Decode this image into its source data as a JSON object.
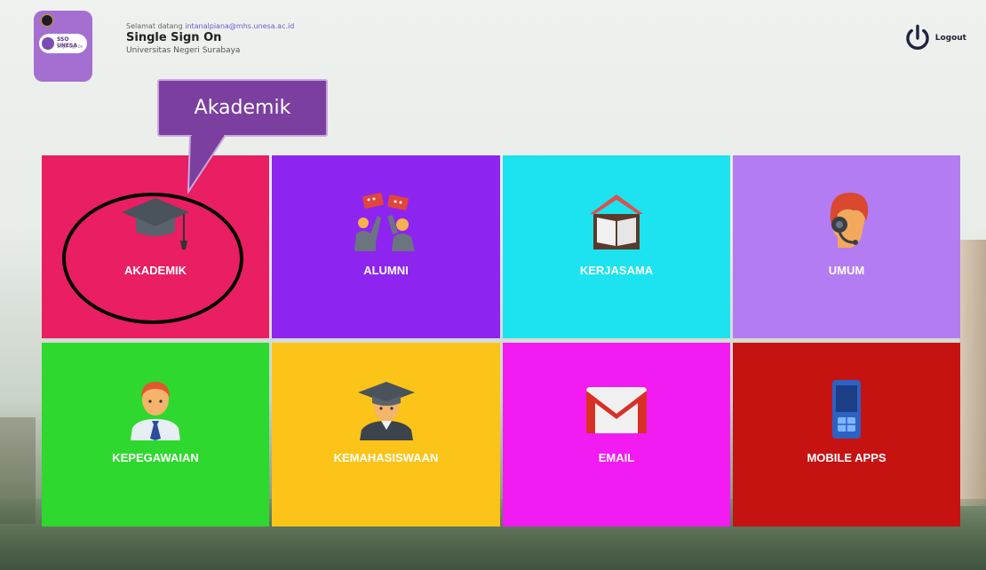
{
  "header": {
    "welcome_prefix": "Selamat datang ",
    "welcome_user": "intanalpiana@mhs.unesa.ac.id",
    "title": "Single Sign On",
    "university": "Universitas Negeri Surabaya",
    "logout_label": "Logout",
    "logo_text": "SSO UNESA",
    "logo_sub": "Single Sign On"
  },
  "callout": {
    "label": "Akademik"
  },
  "tiles": [
    {
      "label": "AKADEMIK",
      "color": "#e91e63",
      "icon": "graduation-cap-icon"
    },
    {
      "label": "ALUMNI",
      "color": "#8e24f0",
      "icon": "alumni-icon"
    },
    {
      "label": "KERJASAMA",
      "color": "#1de3f0",
      "icon": "book-house-icon"
    },
    {
      "label": "UMUM",
      "color": "#b47cf2",
      "icon": "headset-person-icon"
    },
    {
      "label": "KEPEGAWAIAN",
      "color": "#2ed82e",
      "icon": "employee-icon"
    },
    {
      "label": "KEMAHASISWAAN",
      "color": "#fcc419",
      "icon": "student-icon"
    },
    {
      "label": "EMAIL",
      "color": "#f21bf2",
      "icon": "gmail-icon"
    },
    {
      "label": "MOBILE APPS",
      "color": "#c71212",
      "icon": "mobile-phone-icon"
    }
  ]
}
